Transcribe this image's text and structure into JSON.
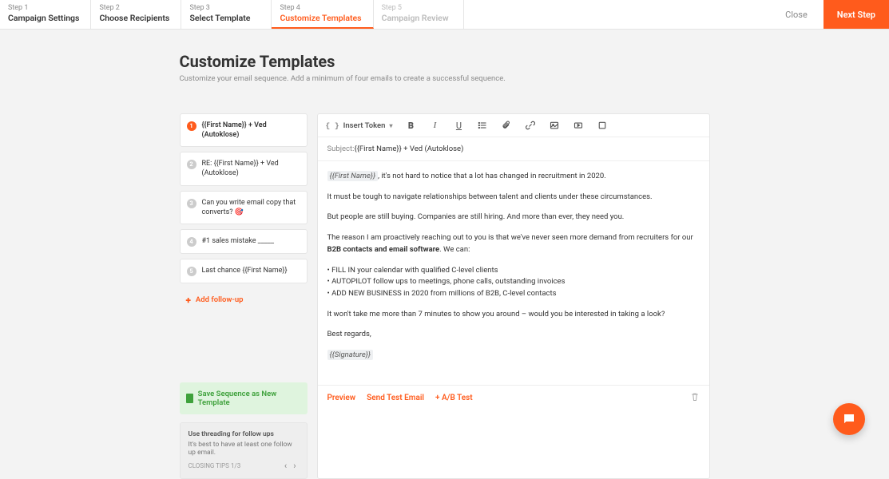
{
  "stepper": [
    {
      "label": "Step 1",
      "title": "Campaign Settings"
    },
    {
      "label": "Step 2",
      "title": "Choose Recipients"
    },
    {
      "label": "Step 3",
      "title": "Select Template"
    },
    {
      "label": "Step 4",
      "title": "Customize Templates"
    },
    {
      "label": "Step 5",
      "title": "Campaign Review"
    }
  ],
  "close": "Close",
  "next": "Next Step",
  "page_title": "Customize Templates",
  "page_sub": "Customize your email sequence. Add a minimum of four emails to create a successful sequence.",
  "sequence": [
    "{{First Name}} + Ved (Autoklose)",
    "RE: {{First Name}} + Ved (Autoklose)",
    "Can you write email copy that converts? 🎯",
    "#1 sales mistake _____",
    "Last chance {{First Name}}"
  ],
  "add_follow": "Add follow-up",
  "save_tpl": "Save Sequence as New Template",
  "tips": {
    "title": "Use threading for follow ups",
    "body": "It's best to have at least one follow up email.",
    "nav": "CLOSING TIPS 1/3"
  },
  "toolbar": {
    "insert_token": "Insert Token"
  },
  "editor": {
    "subject_label": "Subject:",
    "subject_value": "{{First Name}} + Ved (Autoklose)",
    "token_firstname": "{{First Name}}",
    "p1_rest": ", it's not hard to notice that a lot has changed in recruitment in 2020.",
    "p2": "It must be tough to navigate relationships between talent and clients under these circumstances.",
    "p3": "But people are still buying. Companies are still hiring. And more than ever, they need you.",
    "p4_a": "The reason I am proactively reaching out to you is that we've never seen more demand from recruiters for our ",
    "p4_b": "B2B contacts and email software",
    "p4_c": ". We can:",
    "bul1": "FILL IN your calendar with qualified C-level clients",
    "bul2": "AUTOPILOT follow ups to meetings, phone calls, outstanding invoices",
    "bul3": "ADD NEW BUSINESS in 2020 from millions of B2B, C-level contacts",
    "p5": "It won't take me more than 7 minutes to show you around – would you be interested in taking a look?",
    "p6": "Best regards,",
    "token_sig": "{{Signature}}"
  },
  "footer": {
    "preview": "Preview",
    "send_test": "Send Test Email",
    "ab": "+ A/B Test"
  }
}
